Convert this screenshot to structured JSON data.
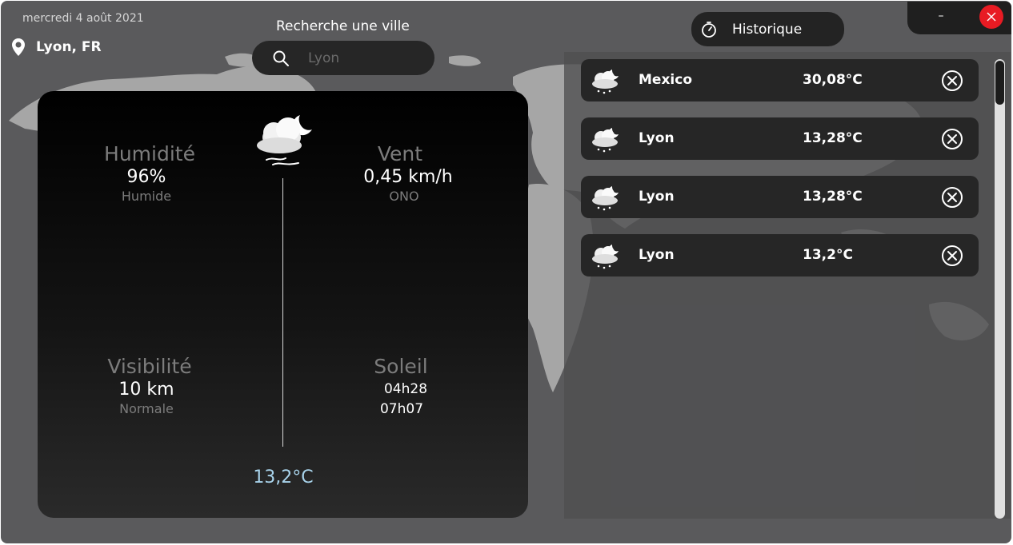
{
  "header": {
    "date": "mercredi 4 août 2021",
    "location": "Lyon, FR"
  },
  "search": {
    "title": "Recherche une ville",
    "placeholder": "Lyon"
  },
  "history_button": {
    "label": "Historique",
    "icon": "clock-icon"
  },
  "window_controls": {
    "minimize": "–",
    "close_color": "#e81b23"
  },
  "current": {
    "icon": "cloudy-night-icon",
    "humidity": {
      "label": "Humidité",
      "value": "96%",
      "sub": "Humide"
    },
    "wind": {
      "label": "Vent",
      "value": "0,45 km/h",
      "sub": "ONO"
    },
    "visibility": {
      "label": "Visibilité",
      "value": "10 km",
      "sub": "Normale"
    },
    "sun": {
      "label": "Soleil",
      "sunrise": "04h28",
      "sunset": "07h07"
    },
    "temperature": "13,2°C",
    "temperature_color": "#a9d4ec"
  },
  "history": [
    {
      "city": "Mexico",
      "temp": "30,08°C",
      "icon": "snow-cloud-icon"
    },
    {
      "city": "Lyon",
      "temp": "13,28°C",
      "icon": "snow-cloud-icon"
    },
    {
      "city": "Lyon",
      "temp": "13,28°C",
      "icon": "snow-cloud-icon"
    },
    {
      "city": "Lyon",
      "temp": "13,2°C",
      "icon": "snow-cloud-icon"
    }
  ]
}
